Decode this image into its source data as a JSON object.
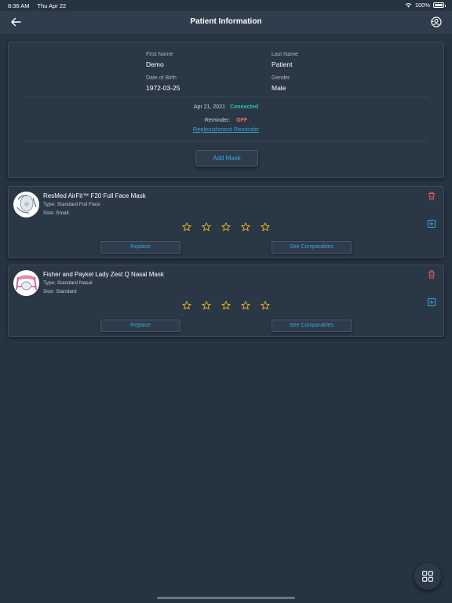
{
  "status": {
    "time": "8:36 AM",
    "date": "Thu Apr 22",
    "battery": "100%"
  },
  "header": {
    "title": "Patient Information"
  },
  "patient": {
    "first_name_label": "First Name",
    "first_name": "Demo",
    "last_name_label": "Last Name",
    "last_name": "Patient",
    "dob_label": "Date of Birth",
    "dob": "1972-03-25",
    "gender_label": "Gender",
    "gender": "Male",
    "connected_date": "Apr 21, 2021",
    "connected_status": "Connected",
    "reminder_label": "Reminder:",
    "reminder_value": "OFF",
    "replenishment_link": "Replenishment Reminder",
    "add_mask_label": "Add Mask"
  },
  "masks": [
    {
      "name": "ResMed AirFit™ F20 Full Face Mask",
      "type": "Type: Standard Full Face",
      "size": "Size: Small",
      "rating": 0,
      "max_rating": 5,
      "replace_label": "Replace",
      "comparables_label": "See Comparables"
    },
    {
      "name": "Fisher and Paykel Lady Zest Q Nasal Mask",
      "type": "Type: Standard Nasal",
      "size": "Size: Standard",
      "rating": 0,
      "max_rating": 5,
      "replace_label": "Replace",
      "comparables_label": "See Comparables"
    }
  ],
  "colors": {
    "accent": "#3aa6dc",
    "connected": "#1fc8b0",
    "off": "#ff6b6b",
    "trash": "#e0555f",
    "star": "#f0b429",
    "background": "#263341"
  },
  "icons": {
    "back": "arrow-left-icon",
    "profile": "user-refresh-icon",
    "trash": "trash-icon",
    "add": "plus-square-icon",
    "star": "star-outline-icon",
    "grid": "grid-icon",
    "wifi": "wifi-icon",
    "battery": "battery-icon"
  }
}
